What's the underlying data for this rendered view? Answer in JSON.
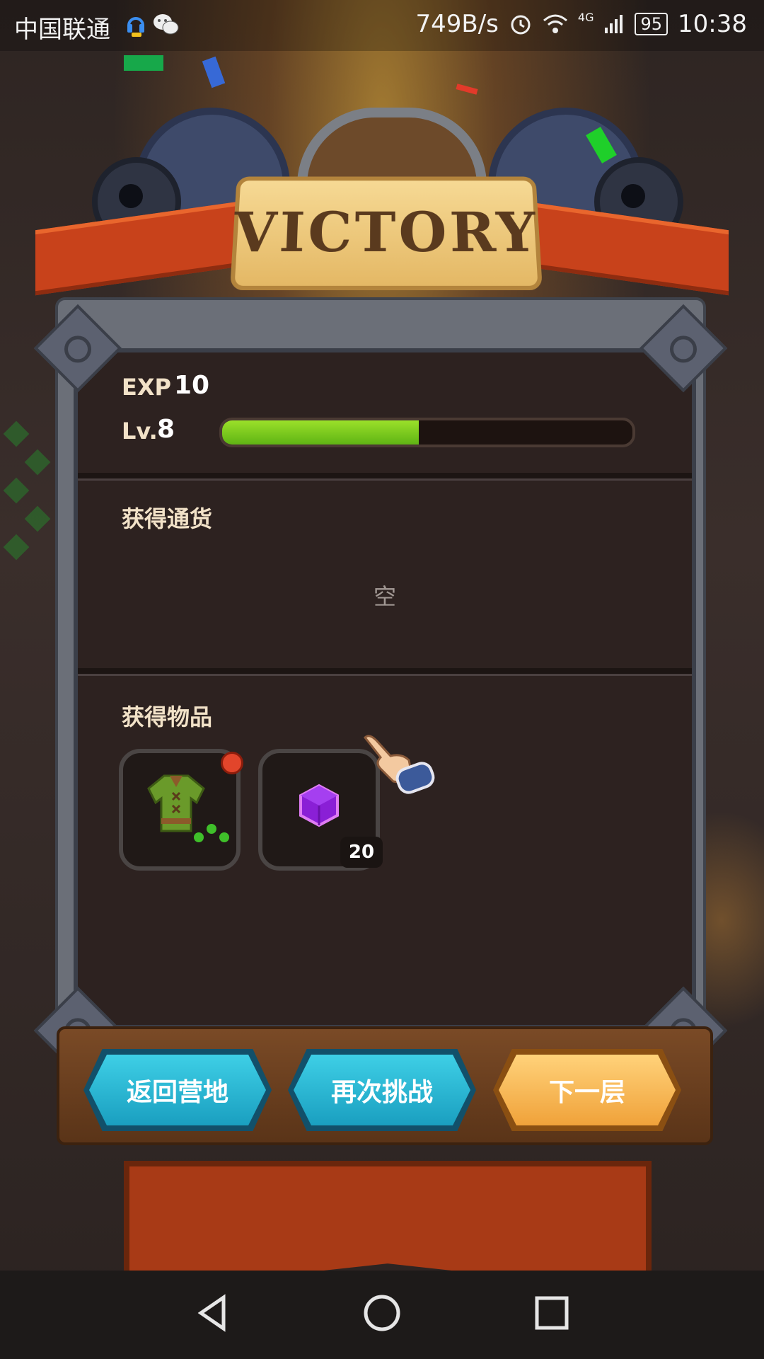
{
  "status_bar": {
    "carrier": "中国联通",
    "net_speed": "749B/s",
    "network_type": "4G",
    "battery": "95",
    "time": "10:38",
    "icons": [
      "headset-icon",
      "wechat-icon",
      "alarm-icon",
      "wifi-icon",
      "signal-icon",
      "battery-icon"
    ]
  },
  "header": {
    "banner_text": "VICTORY"
  },
  "experience": {
    "exp_label": "EXP",
    "exp_value": "10",
    "level_label": "Lv.",
    "level_value": "8",
    "progress_fraction": 0.48
  },
  "currency_section": {
    "title": "获得通货",
    "empty_text": "空"
  },
  "items_section": {
    "title": "获得物品",
    "items": [
      {
        "name": "green-tunic",
        "icon": "tunic-icon",
        "count": ""
      },
      {
        "name": "purple-cube",
        "icon": "purple-cube-icon",
        "count": "20"
      }
    ]
  },
  "buttons": {
    "return_camp": "返回营地",
    "retry": "再次挑战",
    "next_floor": "下一层"
  },
  "colors": {
    "teal_button": "#1a9fc0",
    "orange_button": "#f0a23a",
    "progress_green": "#7ccf1e",
    "panel_dark": "#2d2220"
  },
  "navigation": {
    "icons": [
      "back-icon",
      "home-icon",
      "recents-icon"
    ]
  }
}
